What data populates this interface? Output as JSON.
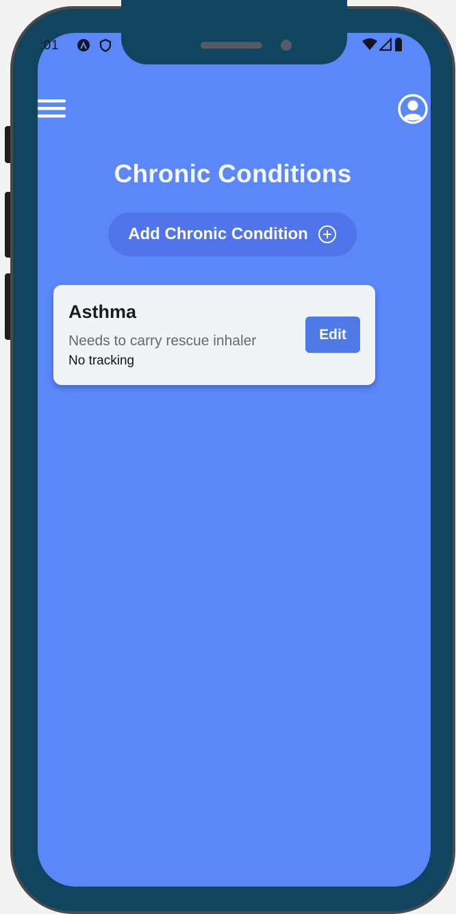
{
  "status_bar": {
    "time": ":01",
    "icons": [
      "app-notification-icon",
      "shield-icon",
      "wifi-icon",
      "signal-icon",
      "battery-icon"
    ]
  },
  "header": {
    "menu_icon": "hamburger-menu-icon",
    "account_icon": "account-circle-icon"
  },
  "page": {
    "title": "Chronic Conditions",
    "add_button_label": "Add Chronic Condition",
    "add_button_icon": "plus-circle-icon"
  },
  "conditions": [
    {
      "name": "Asthma",
      "description": "Needs to carry rescue inhaler",
      "tracking": "No tracking",
      "edit_label": "Edit"
    }
  ],
  "colors": {
    "frame": "#10445f",
    "screen_background": "#5b87f8",
    "button_primary": "#5075ea",
    "card_background": "#f0f4f6",
    "title_text": "#f5f7ff"
  }
}
